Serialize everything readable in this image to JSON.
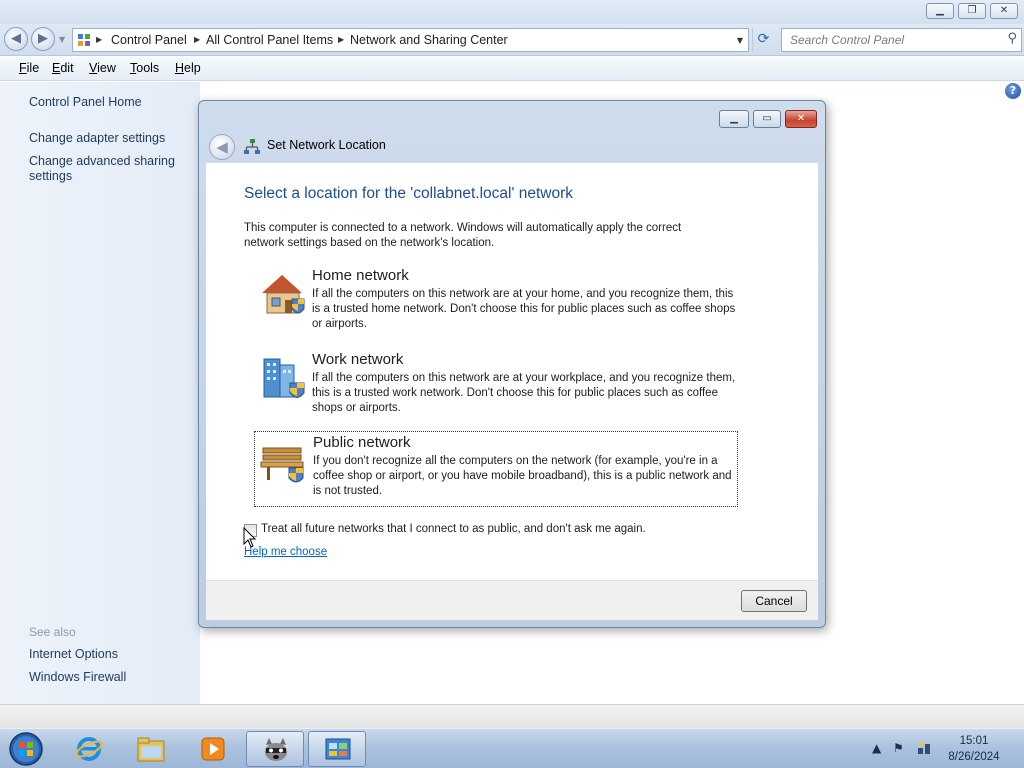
{
  "window": {
    "minimize_icon": "minimize-icon",
    "maximize_icon": "restore-icon",
    "close_icon": "close-icon"
  },
  "address": {
    "breadcrumbs": [
      "Control Panel",
      "All Control Panel Items",
      "Network and Sharing Center"
    ],
    "search_placeholder": "Search Control Panel"
  },
  "menu": [
    {
      "label": "File",
      "key": "F"
    },
    {
      "label": "Edit",
      "key": "E"
    },
    {
      "label": "View",
      "key": "V"
    },
    {
      "label": "Tools",
      "key": "T"
    },
    {
      "label": "Help",
      "key": "H"
    }
  ],
  "sidebar": {
    "home": "Control Panel Home",
    "links": [
      "Change adapter settings",
      "Change advanced sharing settings"
    ],
    "see_also_title": "See also",
    "see_also": [
      "Internet Options",
      "Windows Firewall"
    ]
  },
  "dialog": {
    "title": "Set Network Location",
    "heading": "Select a location for the 'collabnet.local' network",
    "intro": "This computer is connected to a network. Windows will automatically apply the correct network settings based on the network's location.",
    "options": [
      {
        "label": "Home network",
        "description": "If all the computers on this network are at your home, and you recognize them, this is a trusted home network.  Don't choose this for public places such as coffee shops or airports.",
        "icon": "home-network-icon",
        "selected": false
      },
      {
        "label": "Work network",
        "description": "If all the computers on this network are at your workplace, and you recognize them, this is a trusted work network.  Don't choose this for public places such as coffee shops or airports.",
        "icon": "work-network-icon",
        "selected": false
      },
      {
        "label": "Public network",
        "description": "If you don't recognize all the computers on the network (for example, you're in a coffee shop or airport, or you have mobile broadband), this is a public network and is not trusted.",
        "icon": "public-network-icon",
        "selected": true
      }
    ],
    "checkbox_label": "Treat all future networks that I connect to as public, and don't ask me again.",
    "checkbox_checked": false,
    "help_link": "Help me choose",
    "cancel_label": "Cancel"
  },
  "taskbar": {
    "items": [
      "start-orb-icon",
      "internet-explorer-icon",
      "windows-explorer-icon",
      "media-player-icon",
      "raccoon-app-icon",
      "control-panel-icon"
    ],
    "active_item": "control-panel-icon",
    "tray_icons": [
      "show-hidden-icons-icon",
      "action-center-flag-icon",
      "network-icon"
    ],
    "time": "15:01",
    "date": "8/26/2024"
  },
  "colors": {
    "heading": "#1f4d8f",
    "link": "#0066cc",
    "sidebar_link": "#1e3a5f",
    "taskbar": "#a9c1dc"
  }
}
